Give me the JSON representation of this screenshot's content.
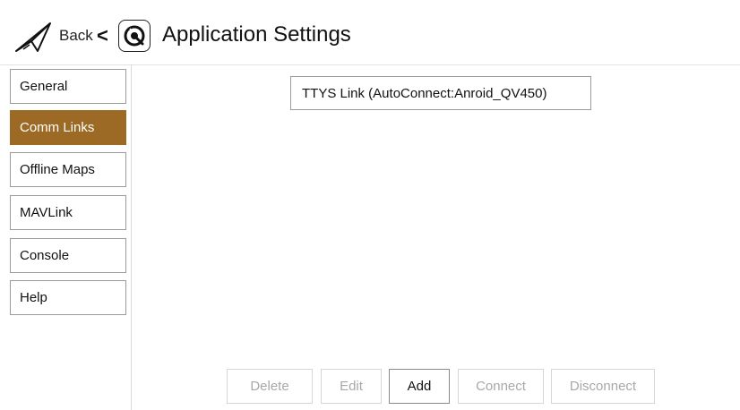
{
  "header": {
    "back_label": "Back",
    "back_chevron": "<",
    "title": "Application Settings",
    "logo_icon": "qgc-logo-icon",
    "menu_icon": "paper-plane-icon"
  },
  "sidebar": {
    "items": [
      {
        "label": "General",
        "active": false
      },
      {
        "label": "Comm Links",
        "active": true
      },
      {
        "label": "Offline Maps",
        "active": false
      },
      {
        "label": "MAVLink",
        "active": false
      },
      {
        "label": "Console",
        "active": false
      },
      {
        "label": "Help",
        "active": false
      }
    ]
  },
  "links": [
    {
      "label": "TTYS Link (AutoConnect:Anroid_QV450)"
    }
  ],
  "actions": {
    "delete": "Delete",
    "edit": "Edit",
    "add": "Add",
    "connect": "Connect",
    "disconnect": "Disconnect"
  },
  "colors": {
    "active_nav": "#9c6a24",
    "disabled_text": "#a8a8a8"
  }
}
